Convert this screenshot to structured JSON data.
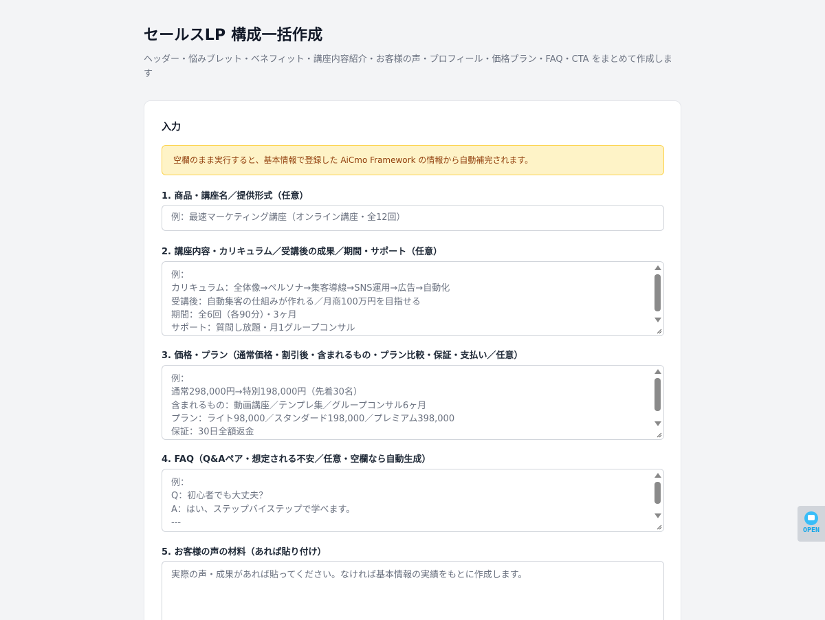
{
  "header": {
    "title": "セールスLP 構成一括作成",
    "subtitle": "ヘッダー・悩みブレット・ベネフィット・講座内容紹介・お客様の声・プロフィール・価格プラン・FAQ・CTA をまとめて作成します"
  },
  "card": {
    "section_title": "入力",
    "notice": "空欄のまま実行すると、基本情報で登録した AiCmo Framework の情報から自動補完されます。"
  },
  "fields": [
    {
      "label": "1. 商品・講座名／提供形式（任意）",
      "placeholder": "例：最速マーケティング講座（オンライン講座・全12回）"
    },
    {
      "label": "2. 講座内容・カリキュラム／受講後の成果／期間・サポート（任意）",
      "placeholder": "例：\nカリキュラム：全体像→ペルソナ→集客導線→SNS運用→広告→自動化\n受講後：自動集客の仕組みが作れる／月商100万円を目指せる\n期間：全6回（各90分）・3ヶ月\nサポート：質問し放題・月1グループコンサル"
    },
    {
      "label": "3. 価格・プラン（通常価格・割引後・含まれるもの・プラン比較・保証・支払い／任意）",
      "placeholder": "例：\n通常298,000円→特別198,000円（先着30名）\n含まれるもの：動画講座／テンプレ集／グループコンサル6ヶ月\nプラン：ライト98,000／スタンダード198,000／プレミアム398,000\n保証：30日全額返金"
    },
    {
      "label": "4. FAQ（Q&Aペア・想定される不安／任意・空欄なら自動生成）",
      "placeholder": "例：\nQ：初心者でも大丈夫？\nA：はい、ステップバイステップで学べます。\n---"
    },
    {
      "label": "5. お客様の声の材料（あれば貼り付け）",
      "placeholder": "実際の声・成果があれば貼ってください。なければ基本情報の実績をもとに作成します。"
    }
  ],
  "side_widget": {
    "label": "OPEN",
    "icon": "chat-icon",
    "color": "#0ea5e9"
  },
  "colors": {
    "background": "#f3f4f6",
    "notice_bg": "#fef3c7",
    "notice_border": "#fcd34d",
    "notice_text": "#92400e"
  }
}
